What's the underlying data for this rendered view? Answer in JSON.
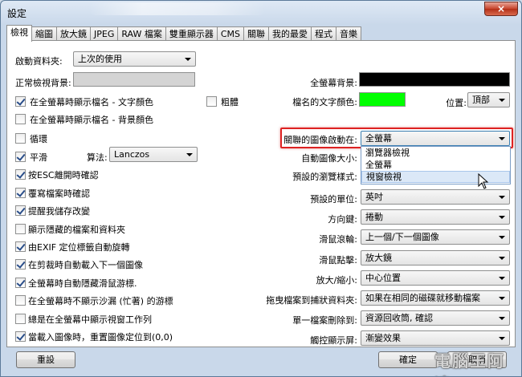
{
  "window": {
    "title": "設定",
    "close_label": "×"
  },
  "tabs": [
    "檢視",
    "縮圖",
    "放大鏡",
    "JPEG",
    "RAW 檔案",
    "雙重顯示器",
    "CMS",
    "關聯",
    "我的最愛",
    "程式",
    "音樂"
  ],
  "active_tab": 0,
  "left": {
    "startup_folder_label": "啟動資料夾:",
    "startup_folder_value": "上次的使用",
    "normal_bg_label": "正常檢視背景:",
    "normal_bg_color": "#d4d4d4",
    "checkboxes": [
      {
        "label": "在全螢幕時顯示檔名 - 文字顏色",
        "checked": true
      },
      {
        "label": "在全螢幕時顯示檔名 - 背景顏色",
        "checked": false
      },
      {
        "label": "循環",
        "checked": false
      },
      {
        "label": "平滑",
        "checked": true
      },
      {
        "label": "按ESC離開時確認",
        "checked": true
      },
      {
        "label": "覆寫檔案時確認",
        "checked": true
      },
      {
        "label": "提醒我儲存改變",
        "checked": true
      },
      {
        "label": "顯示隱藏的檔案和資料夾",
        "checked": false
      },
      {
        "label": "由EXIF 定位標籤自動旋轉",
        "checked": true
      },
      {
        "label": "在剪裁時自動載入下一個圖像",
        "checked": true
      },
      {
        "label": "全螢幕時自動隱藏滑鼠游標.",
        "checked": true
      },
      {
        "label": "在全螢幕時不顯示沙漏 (忙著) 的游標",
        "checked": false
      },
      {
        "label": "總是在全螢幕中顯示視窗工作列",
        "checked": false
      },
      {
        "label": "當載入圖像時，重置圖像定位到(0,0)",
        "checked": true
      }
    ],
    "bold": {
      "label": "粗體",
      "checked": false
    },
    "algorithm_label": "算法:",
    "algorithm_value": "Lanczos"
  },
  "right": {
    "fullscreen_bg_label": "全螢幕背景:",
    "fullscreen_bg_color": "#000000",
    "filename_color_label": "檔名的文字顏色:",
    "filename_color": "#00ff00",
    "position_label": "位置:",
    "position_value": "頂部",
    "rows": [
      {
        "label": "關聯的圖像啟動在:",
        "value": "全螢幕"
      },
      {
        "label": "自動圖像大小:",
        "value": ""
      },
      {
        "label": "預設的瀏覽樣式:",
        "value": ""
      },
      {
        "label": "預設的單位:",
        "value": "英吋"
      },
      {
        "label": "方向鍵:",
        "value": "捲動"
      },
      {
        "label": "滑鼠滾輪:",
        "value": "上一個/下一個圖像"
      },
      {
        "label": "滑鼠點擊:",
        "value": "放大鏡"
      },
      {
        "label": "放大/縮小:",
        "value": "中心位置"
      },
      {
        "label": "拖曳檔案到捕狀資料夾:",
        "value": "如果在相同的磁碟就移動檔案"
      },
      {
        "label": "單一檔案刪除到:",
        "value": "資源回收筒, 確認"
      },
      {
        "label": "觸控顯示屏:",
        "value": "漸變效果"
      }
    ],
    "dropdown_options": [
      "瀏覽器檢視",
      "全螢幕",
      "視窗檢視"
    ],
    "dropdown_hover_index": 2
  },
  "footer": {
    "reset_label": "重設",
    "ok_label": "確定",
    "cancel_label": "取消"
  },
  "watermark": {
    "text": "電腦王阿達",
    "url": "http://www.kocpc.com.tw"
  },
  "colors": {
    "highlight_border": "#dd2222",
    "accent_hover": "#dbe8f7"
  }
}
